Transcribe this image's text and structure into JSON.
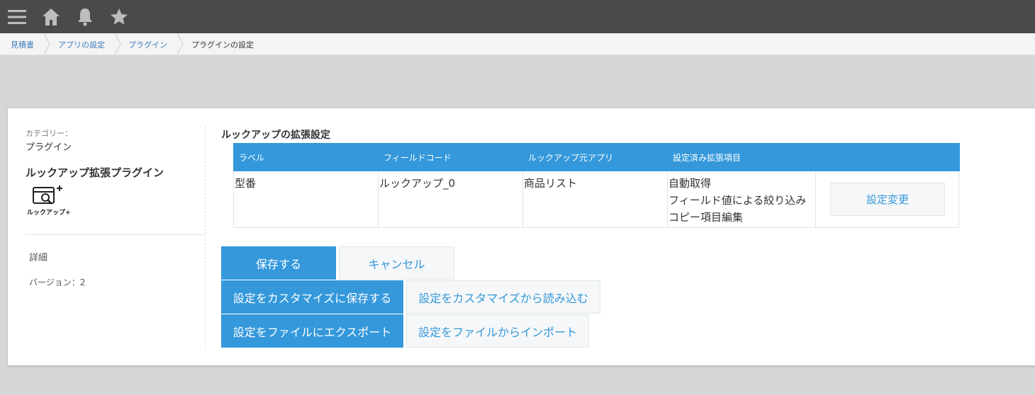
{
  "header": {
    "icons": [
      "menu-icon",
      "home-icon",
      "bell-icon",
      "star-icon"
    ]
  },
  "breadcrumb": {
    "items": [
      "見積書",
      "アプリの設定",
      "プラグイン"
    ],
    "current": "プラグインの設定"
  },
  "sidebar": {
    "category_label": "カテゴリー：",
    "category_value": "プラグイン",
    "plugin_name": "ルックアップ拡張プラグイン",
    "logo_text": "ルックアップ+",
    "detail_label": "詳細",
    "version_label": "バージョン：2"
  },
  "main": {
    "section_title": "ルックアップの拡張設定",
    "table": {
      "headers": [
        "ラベル",
        "フィールドコード",
        "ルックアップ元アプリ",
        "設定済み拡張項目"
      ],
      "rows": [
        {
          "label": "型番",
          "field_code": "ルックアップ_0",
          "source_app": "商品リスト",
          "items": [
            "自動取得",
            "フィールド値による絞り込み",
            "コピー項目編集"
          ],
          "button": "設定変更"
        }
      ]
    },
    "buttons": {
      "save": "保存する",
      "cancel": "キャンセル",
      "save_customize": "設定をカスタマイズに保存する",
      "load_customize": "設定をカスタマイズから読み込む",
      "export_file": "設定をファイルにエクスポート",
      "import_file": "設定をファイルからインポート"
    }
  },
  "colors": {
    "accent": "#3498db",
    "header_bg": "#4a4a4a",
    "page_bg": "#d6d6d6"
  }
}
